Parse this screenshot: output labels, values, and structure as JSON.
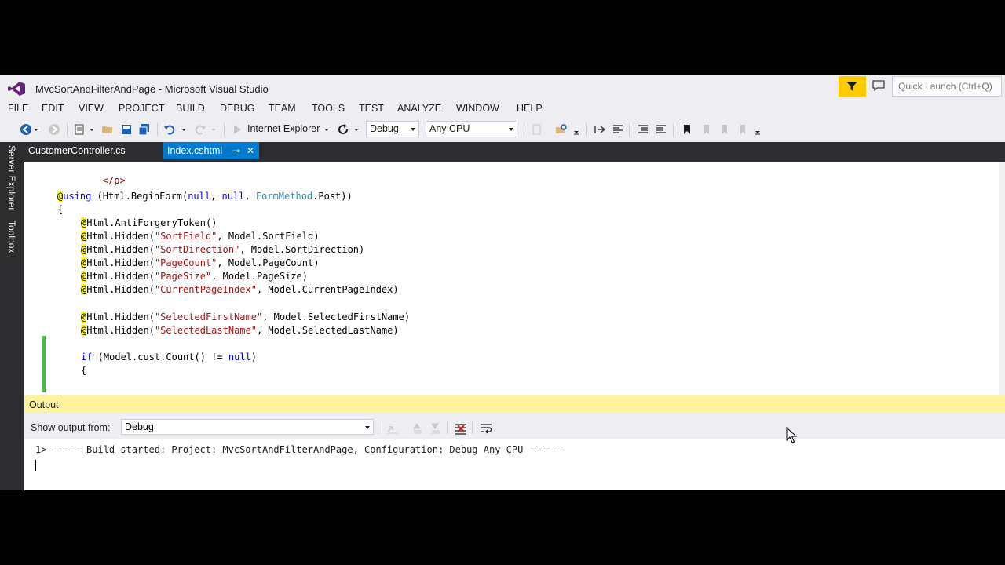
{
  "window": {
    "title": "MvcSortAndFilterAndPage - Microsoft Visual Studio"
  },
  "quick_launch": {
    "placeholder": "Quick Launch (Ctrl+Q)"
  },
  "menu": [
    "FILE",
    "EDIT",
    "VIEW",
    "PROJECT",
    "BUILD",
    "DEBUG",
    "TEAM",
    "TOOLS",
    "TEST",
    "ANALYZE",
    "WINDOW",
    "HELP"
  ],
  "toolbar": {
    "browser_label": "Internet Explorer",
    "configuration": "Debug",
    "platform": "Any CPU"
  },
  "side_tabs": [
    "Server Explorer",
    "Toolbox"
  ],
  "tabs": [
    {
      "label": "CustomerController.cs",
      "active": false
    },
    {
      "label": "Index.cshtml",
      "active": true
    }
  ],
  "code": {
    "l1": "</p>",
    "l2_razor": "@",
    "l2_kw": "using",
    "l2_a": " (Html.BeginForm(",
    "l2_null1": "null",
    "l2_b": ", ",
    "l2_null2": "null",
    "l2_c": ", ",
    "l2_type": "FormMethod",
    "l2_d": ".Post))",
    "l3": "{",
    "l4_a": "Html.AntiForgeryToken()",
    "l5_a": "Html.Hidden(",
    "l5_str": "\"SortField\"",
    "l5_b": ", Model.SortField)",
    "l6_a": "Html.Hidden(",
    "l6_str": "\"SortDirection\"",
    "l6_b": ", Model.SortDirection)",
    "l7_a": "Html.Hidden(",
    "l7_str": "\"PageCount\"",
    "l7_b": ", Model.PageCount)",
    "l8_a": "Html.Hidden(",
    "l8_str": "\"PageSize\"",
    "l8_b": ", Model.PageSize)",
    "l9_a": "Html.Hidden(",
    "l9_str": "\"CurrentPageIndex\"",
    "l9_b": ", Model.CurrentPageIndex)",
    "l10_a": "Html.Hidden(",
    "l10_str": "\"SelectedFirstName\"",
    "l10_b": ", Model.SelectedFirstName)",
    "l11_a": "Html.Hidden(",
    "l11_str": "\"SelectedLastName\"",
    "l11_b": ", Model.SelectedLastName)",
    "l12_kw": "if",
    "l12_a": " (Model.cust.Count() != ",
    "l12_null": "null",
    "l12_b": ")",
    "l13": "{"
  },
  "output": {
    "title": "Output",
    "show_from_label": "Show output from:",
    "source": "Debug",
    "line1": "1>------ Build started: Project: MvcSortAndFilterAndPage, Configuration: Debug Any CPU ------"
  }
}
